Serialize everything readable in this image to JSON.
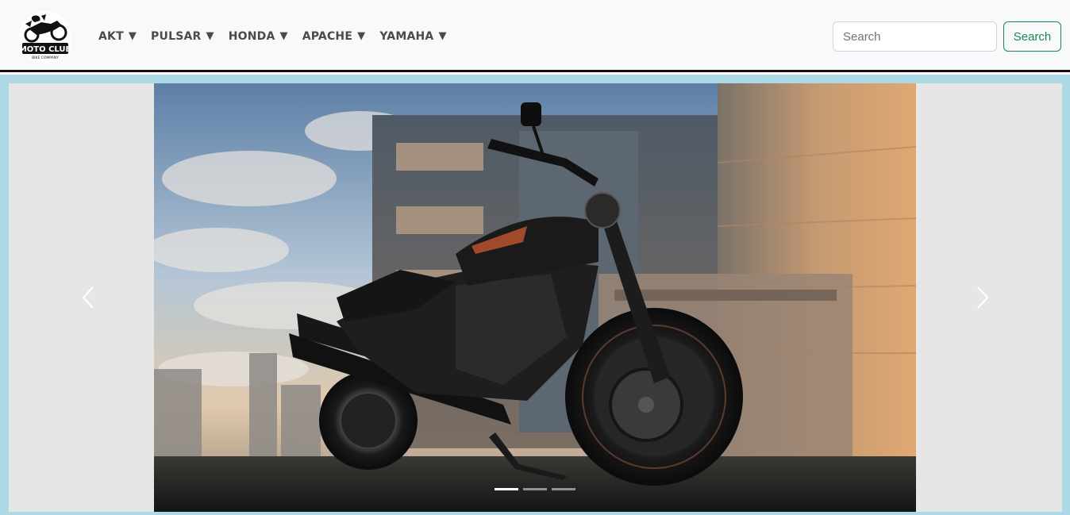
{
  "brand": {
    "logo_text": "MOTO CLUB",
    "logo_subtext": "BIKE COMPANY"
  },
  "nav": {
    "items": [
      {
        "label": "AKT",
        "caret": "▼"
      },
      {
        "label": "PULSAR",
        "caret": "▼"
      },
      {
        "label": "HONDA",
        "caret": "▼"
      },
      {
        "label": "APACHE",
        "caret": "▼"
      },
      {
        "label": "YAMAHA",
        "caret": "▼"
      }
    ]
  },
  "search": {
    "placeholder": "Search",
    "value": "",
    "button_label": "Search"
  },
  "carousel": {
    "slide_count": 3,
    "active_index": 0,
    "prev_icon": "chevron-left-icon",
    "next_icon": "chevron-right-icon"
  },
  "colors": {
    "navbar_bg": "#f8f9fa",
    "search_button": "#198754",
    "carousel_frame": "#add8e6",
    "carousel_bg": "#e6e6e6"
  }
}
